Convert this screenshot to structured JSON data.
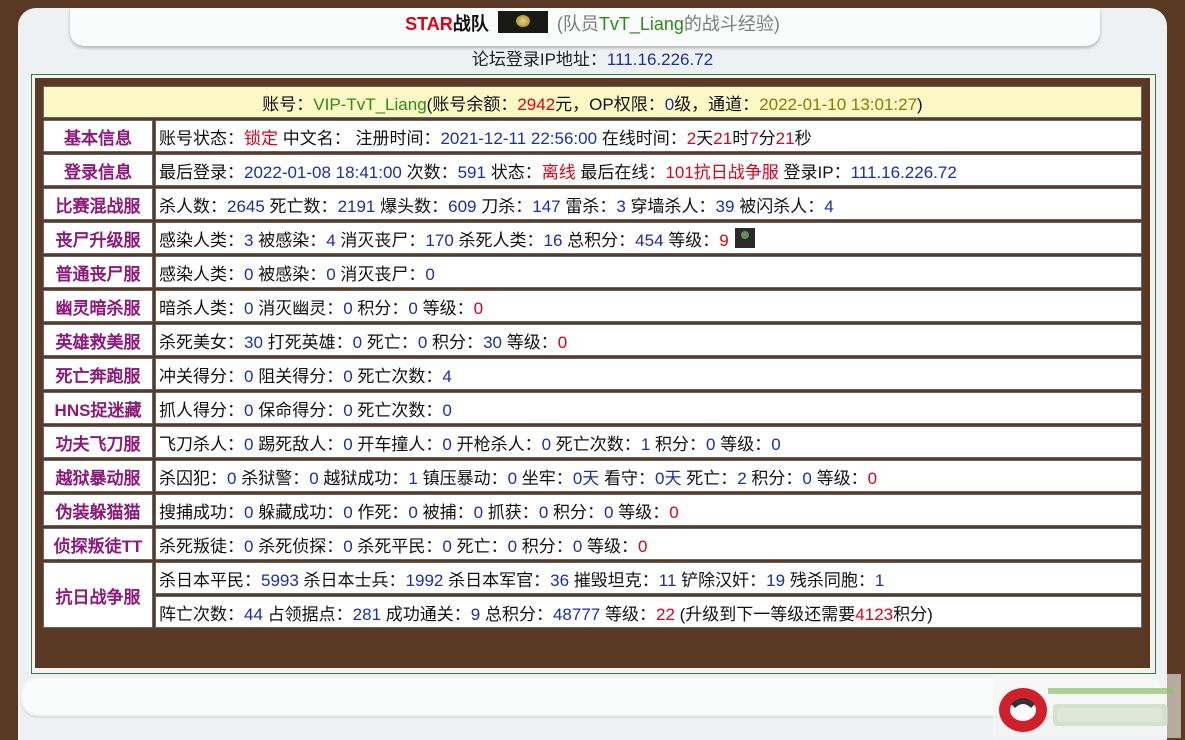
{
  "header": {
    "team_star": "STAR",
    "team_name": "战队",
    "open_paren": "(队员",
    "player": "TvT_Liang",
    "suffix": "的战斗经验)"
  },
  "login_ip": {
    "label": "论坛登录IP地址：",
    "value": "111.16.226.72"
  },
  "account": {
    "label": "账号：",
    "id": "VIP-TvT_Liang",
    "balance_label": "(账号余额：",
    "balance": "2942",
    "balance_unit": "元，OP权限：",
    "op": "0",
    "op_unit": "级，通道：",
    "channel_time": "2022-01-10 13:01:27",
    "close": ")"
  },
  "rows": [
    {
      "label": "基本信息",
      "parts": [
        {
          "t": "账号状态："
        },
        {
          "t": "锁定",
          "c": "red"
        },
        {
          "t": " 中文名： 注册时间："
        },
        {
          "t": "2021-12-11 22:56:00",
          "c": "blue"
        },
        {
          "t": " 在线时间："
        },
        {
          "t": "2",
          "c": "red"
        },
        {
          "t": "天"
        },
        {
          "t": "21",
          "c": "red"
        },
        {
          "t": "时"
        },
        {
          "t": "7",
          "c": "red"
        },
        {
          "t": "分"
        },
        {
          "t": "21",
          "c": "red"
        },
        {
          "t": "秒"
        }
      ]
    },
    {
      "label": "登录信息",
      "parts": [
        {
          "t": "最后登录："
        },
        {
          "t": "2022-01-08 18:41:00",
          "c": "blue"
        },
        {
          "t": " 次数："
        },
        {
          "t": "591",
          "c": "blue"
        },
        {
          "t": " 状态："
        },
        {
          "t": "离线",
          "c": "red"
        },
        {
          "t": " 最后在线："
        },
        {
          "t": "101抗日战争服",
          "c": "red"
        },
        {
          "t": " 登录IP："
        },
        {
          "t": "111.16.226.72",
          "c": "blue"
        }
      ]
    },
    {
      "label": "比赛混战服",
      "parts": [
        {
          "t": "杀人数："
        },
        {
          "t": "2645",
          "c": "blue"
        },
        {
          "t": " 死亡数："
        },
        {
          "t": "2191",
          "c": "blue"
        },
        {
          "t": " 爆头数："
        },
        {
          "t": "609",
          "c": "blue"
        },
        {
          "t": " 刀杀："
        },
        {
          "t": "147",
          "c": "blue"
        },
        {
          "t": " 雷杀："
        },
        {
          "t": "3",
          "c": "blue"
        },
        {
          "t": " 穿墙杀人："
        },
        {
          "t": "39",
          "c": "blue"
        },
        {
          "t": " 被闪杀人："
        },
        {
          "t": "4",
          "c": "blue"
        }
      ]
    },
    {
      "label": "丧尸升级服",
      "avatar": true,
      "parts": [
        {
          "t": "感染人类："
        },
        {
          "t": "3",
          "c": "blue"
        },
        {
          "t": " 被感染："
        },
        {
          "t": "4",
          "c": "blue"
        },
        {
          "t": " 消灭丧尸："
        },
        {
          "t": "170",
          "c": "blue"
        },
        {
          "t": " 杀死人类："
        },
        {
          "t": "16",
          "c": "blue"
        },
        {
          "t": " 总积分："
        },
        {
          "t": "454",
          "c": "blue"
        },
        {
          "t": " 等级："
        },
        {
          "t": "9",
          "c": "red"
        }
      ]
    },
    {
      "label": "普通丧尸服",
      "parts": [
        {
          "t": "感染人类："
        },
        {
          "t": "0",
          "c": "blue"
        },
        {
          "t": " 被感染："
        },
        {
          "t": "0",
          "c": "blue"
        },
        {
          "t": " 消灭丧尸："
        },
        {
          "t": "0",
          "c": "blue"
        }
      ]
    },
    {
      "label": "幽灵暗杀服",
      "parts": [
        {
          "t": "暗杀人类："
        },
        {
          "t": "0",
          "c": "blue"
        },
        {
          "t": " 消灭幽灵："
        },
        {
          "t": "0",
          "c": "blue"
        },
        {
          "t": " 积分："
        },
        {
          "t": "0",
          "c": "blue"
        },
        {
          "t": " 等级："
        },
        {
          "t": "0",
          "c": "red"
        }
      ]
    },
    {
      "label": "英雄救美服",
      "parts": [
        {
          "t": "杀死美女："
        },
        {
          "t": "30",
          "c": "blue"
        },
        {
          "t": " 打死英雄："
        },
        {
          "t": "0",
          "c": "blue"
        },
        {
          "t": " 死亡："
        },
        {
          "t": "0",
          "c": "blue"
        },
        {
          "t": " 积分："
        },
        {
          "t": "30",
          "c": "blue"
        },
        {
          "t": " 等级："
        },
        {
          "t": "0",
          "c": "red"
        }
      ]
    },
    {
      "label": "死亡奔跑服",
      "parts": [
        {
          "t": "冲关得分："
        },
        {
          "t": "0",
          "c": "blue"
        },
        {
          "t": " 阻关得分："
        },
        {
          "t": "0",
          "c": "blue"
        },
        {
          "t": " 死亡次数："
        },
        {
          "t": "4",
          "c": "blue"
        }
      ]
    },
    {
      "label": "HNS捉迷藏",
      "parts": [
        {
          "t": "抓人得分："
        },
        {
          "t": "0",
          "c": "blue"
        },
        {
          "t": " 保命得分："
        },
        {
          "t": "0",
          "c": "blue"
        },
        {
          "t": " 死亡次数："
        },
        {
          "t": "0",
          "c": "blue"
        }
      ]
    },
    {
      "label": "功夫飞刀服",
      "parts": [
        {
          "t": "飞刀杀人："
        },
        {
          "t": "0",
          "c": "blue"
        },
        {
          "t": " 踢死敌人："
        },
        {
          "t": "0",
          "c": "blue"
        },
        {
          "t": " 开车撞人："
        },
        {
          "t": "0",
          "c": "blue"
        },
        {
          "t": " 开枪杀人："
        },
        {
          "t": "0",
          "c": "blue"
        },
        {
          "t": " 死亡次数："
        },
        {
          "t": "1",
          "c": "blue"
        },
        {
          "t": " 积分："
        },
        {
          "t": "0",
          "c": "blue"
        },
        {
          "t": " 等级："
        },
        {
          "t": "0",
          "c": "blue"
        }
      ]
    },
    {
      "label": "越狱暴动服",
      "parts": [
        {
          "t": "杀囚犯："
        },
        {
          "t": "0",
          "c": "blue"
        },
        {
          "t": " 杀狱警："
        },
        {
          "t": "0",
          "c": "blue"
        },
        {
          "t": " 越狱成功："
        },
        {
          "t": "1",
          "c": "blue"
        },
        {
          "t": " 镇压暴动："
        },
        {
          "t": "0",
          "c": "blue"
        },
        {
          "t": " 坐牢："
        },
        {
          "t": "0天",
          "c": "blue"
        },
        {
          "t": " 看守："
        },
        {
          "t": "0天",
          "c": "blue"
        },
        {
          "t": " 死亡："
        },
        {
          "t": "2",
          "c": "blue"
        },
        {
          "t": " 积分："
        },
        {
          "t": "0",
          "c": "blue"
        },
        {
          "t": " 等级："
        },
        {
          "t": "0",
          "c": "red"
        }
      ]
    },
    {
      "label": "伪装躲猫猫",
      "parts": [
        {
          "t": "搜捕成功："
        },
        {
          "t": "0",
          "c": "blue"
        },
        {
          "t": " 躲藏成功："
        },
        {
          "t": "0",
          "c": "blue"
        },
        {
          "t": " 作死："
        },
        {
          "t": "0",
          "c": "blue"
        },
        {
          "t": " 被捕："
        },
        {
          "t": "0",
          "c": "blue"
        },
        {
          "t": " 抓获："
        },
        {
          "t": "0",
          "c": "blue"
        },
        {
          "t": " 积分："
        },
        {
          "t": "0",
          "c": "blue"
        },
        {
          "t": " 等级："
        },
        {
          "t": "0",
          "c": "red"
        }
      ]
    },
    {
      "label": "侦探叛徒TT",
      "parts": [
        {
          "t": "杀死叛徒："
        },
        {
          "t": "0",
          "c": "blue"
        },
        {
          "t": " 杀死侦探："
        },
        {
          "t": "0",
          "c": "blue"
        },
        {
          "t": " 杀死平民："
        },
        {
          "t": "0",
          "c": "blue"
        },
        {
          "t": " 死亡："
        },
        {
          "t": "0",
          "c": "blue"
        },
        {
          "t": " 积分："
        },
        {
          "t": "0",
          "c": "blue"
        },
        {
          "t": " 等级："
        },
        {
          "t": "0",
          "c": "red"
        }
      ]
    }
  ],
  "war_row": {
    "label": "抗日战争服",
    "line1": [
      {
        "t": "杀日本平民："
      },
      {
        "t": "5993",
        "c": "blue"
      },
      {
        "t": " 杀日本士兵："
      },
      {
        "t": "1992",
        "c": "blue"
      },
      {
        "t": " 杀日本军官："
      },
      {
        "t": "36",
        "c": "blue"
      },
      {
        "t": " 摧毁坦克："
      },
      {
        "t": "11",
        "c": "blue"
      },
      {
        "t": " 铲除汉奸："
      },
      {
        "t": "19",
        "c": "blue"
      },
      {
        "t": " 残杀同胞："
      },
      {
        "t": "1",
        "c": "blue"
      }
    ],
    "line2": [
      {
        "t": "阵亡次数："
      },
      {
        "t": "44",
        "c": "blue"
      },
      {
        "t": " 占领据点："
      },
      {
        "t": "281",
        "c": "blue"
      },
      {
        "t": " 成功通关："
      },
      {
        "t": "9",
        "c": "blue"
      },
      {
        "t": " 总积分："
      },
      {
        "t": "48777",
        "c": "blue"
      },
      {
        "t": " 等级："
      },
      {
        "t": "22",
        "c": "red"
      },
      {
        "t": " (升级到下一等级还需要"
      },
      {
        "t": "4123",
        "c": "red"
      },
      {
        "t": "积分)"
      }
    ]
  },
  "colors": {
    "label": "#8b1a7a",
    "blue": "#1a2fa8",
    "red": "#e0001a",
    "olive": "#8c7a00",
    "green": "#2f8a1a",
    "frame": "#5a3a25"
  },
  "icons": {
    "team_emblem": "team-emblem-icon",
    "zombie_rank": "zombie-rank-avatar-icon",
    "site_logo": "site-logo-icon"
  }
}
